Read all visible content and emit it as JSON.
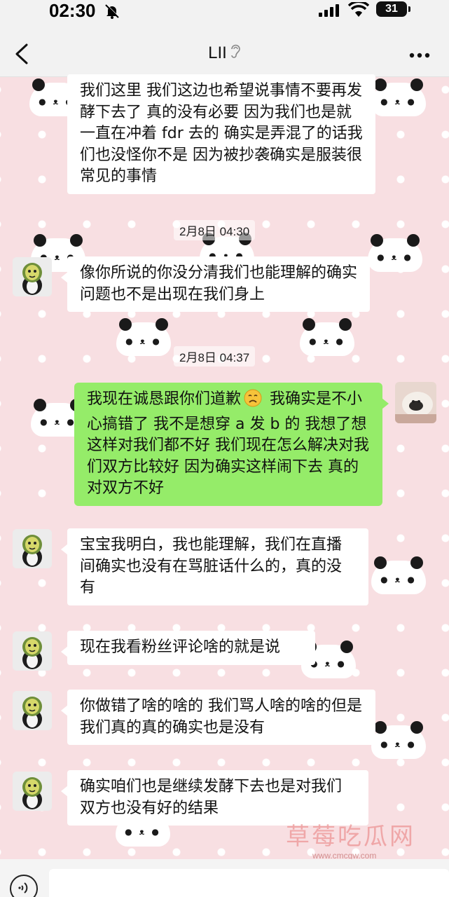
{
  "status_bar": {
    "time": "02:30",
    "battery": "31"
  },
  "header": {
    "title": "LII"
  },
  "timestamps": [
    "2月8日 04:30",
    "2月8日 04:37"
  ],
  "messages": [
    {
      "sender": "other",
      "text": "我们这里 我们这边也希望说事情不要再发酵下去了 真的没有必要 因为我们也是就一直在冲着 fdr 去的 确实是弄混了的话我们也没怪你不是 因为被抄袭确实是服装很常见的事情"
    },
    {
      "sender": "other",
      "text": "像你所说的你没分清我们也能理解的确实问题也不是出现在我们身上"
    },
    {
      "sender": "me",
      "text_part1": "我现在诚恳跟你们道歉",
      "emoji": "sad-face",
      "text_part2": " 我确实是不小心搞错了  我不是想穿 a 发 b 的 我想了想这样对我们都不好  我们现在怎么解决对我们双方比较好 因为确实这样闹下去 真的对双方不好"
    },
    {
      "sender": "other",
      "text": "宝宝我明白，我也能理解，我们在直播间确实也没有在骂脏话什么的，真的没有"
    },
    {
      "sender": "other",
      "text": "现在我看粉丝评论啥的就是说"
    },
    {
      "sender": "other",
      "text": "你做错了啥的啥的 我们骂人啥的啥的但是我们真的真的确实也是没有"
    },
    {
      "sender": "other",
      "text": "确实咱们也是继续发酵下去也是对我们双方也没有好的结果"
    }
  ],
  "watermark": {
    "text": "草莓吃瓜网",
    "url": "www.cmcgw.com"
  },
  "colors": {
    "my_bubble": "#95ec69",
    "their_bubble": "#ffffff",
    "background": "#f8dfe2"
  }
}
